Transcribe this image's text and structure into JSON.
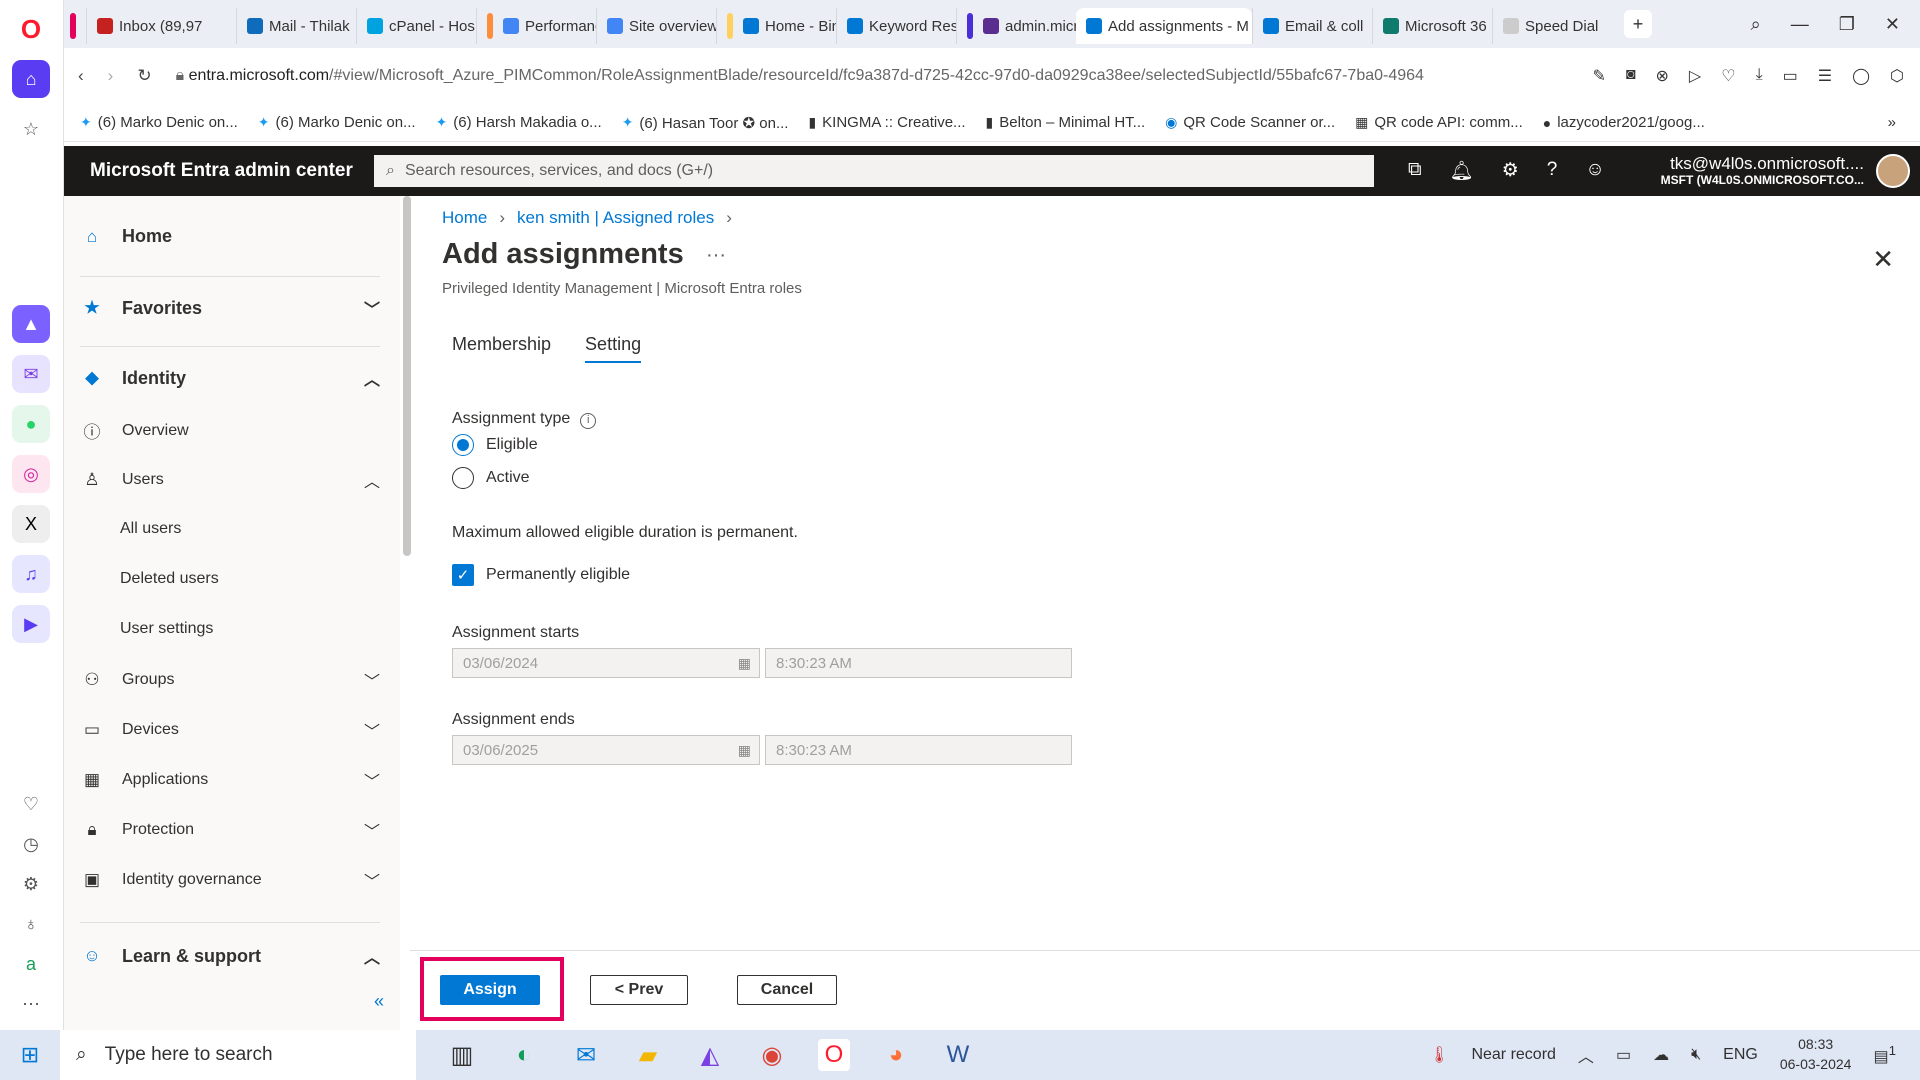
{
  "browser": {
    "tabs": [
      {
        "label": "Inbox (89,97",
        "color": "#c5221f"
      },
      {
        "label": "Mail - Thilak",
        "color": "#0f6cbd"
      },
      {
        "label": "cPanel - Hos",
        "color": "#00a3e0"
      },
      {
        "label": "Performance",
        "color": "#4285f4"
      },
      {
        "label": "Site overview",
        "color": "#4285f4"
      },
      {
        "label": "Home - Bing",
        "color": "#0078d4"
      },
      {
        "label": "Keyword Res",
        "color": "#0078d4"
      },
      {
        "label": "admin.micro",
        "color": "#5c2d91"
      },
      {
        "label": "Add assignments - M",
        "color": "#0078d4"
      },
      {
        "label": "Email & coll",
        "color": "#0078d4"
      },
      {
        "label": "Microsoft 36",
        "color": "#0f7b6c"
      },
      {
        "label": "Speed Dial",
        "color": "#666666"
      }
    ],
    "url_host": "entra.microsoft.com",
    "url_path": "/#view/Microsoft_Azure_PIMCommon/RoleAssignmentBlade/resourceId/fc9a387d-d725-42cc-97d0-da0929ca38ee/selectedSubjectId/55bafc67-7ba0-4964",
    "bookmarks": [
      "(6) Marko Denic on...",
      "(6) Marko Denic on...",
      "(6) Harsh Makadia o...",
      "(6) Hasan Toor ✪ on...",
      "KINGMA :: Creative...",
      "Belton – Minimal HT...",
      "QR Code Scanner or...",
      "QR code API: comm...",
      "lazycoder2021/goog..."
    ]
  },
  "portal": {
    "brand": "Microsoft Entra admin center",
    "search_placeholder": "Search resources, services, and docs (G+/)",
    "user_email": "tks@w4l0s.onmicrosoft....",
    "user_tenant": "MSFT (W4L0S.ONMICROSOFT.CO..."
  },
  "nav": {
    "home": "Home",
    "favorites": "Favorites",
    "identity": "Identity",
    "overview": "Overview",
    "users": "Users",
    "all_users": "All users",
    "deleted_users": "Deleted users",
    "user_settings": "User settings",
    "groups": "Groups",
    "devices": "Devices",
    "applications": "Applications",
    "protection": "Protection",
    "identity_governance": "Identity governance",
    "learn_support": "Learn & support"
  },
  "page": {
    "breadcrumb_home": "Home",
    "breadcrumb_user": "ken smith | Assigned roles",
    "title": "Add assignments",
    "subtitle": "Privileged Identity Management | Microsoft Entra roles",
    "tab_membership": "Membership",
    "tab_setting": "Setting",
    "assignment_type_label": "Assignment type",
    "option_eligible": "Eligible",
    "option_active": "Active",
    "duration_note": "Maximum allowed eligible duration is permanent.",
    "permanently_eligible": "Permanently eligible",
    "starts_label": "Assignment starts",
    "starts_date": "03/06/2024",
    "starts_time": "8:30:23 AM",
    "ends_label": "Assignment ends",
    "ends_date": "03/06/2025",
    "ends_time": "8:30:23 AM"
  },
  "footer": {
    "assign": "Assign",
    "prev": "< Prev",
    "cancel": "Cancel"
  },
  "taskbar": {
    "search_placeholder": "Type here to search",
    "weather": "Near record",
    "lang": "ENG",
    "time": "08:33",
    "date": "06-03-2024",
    "notifications": "1"
  }
}
